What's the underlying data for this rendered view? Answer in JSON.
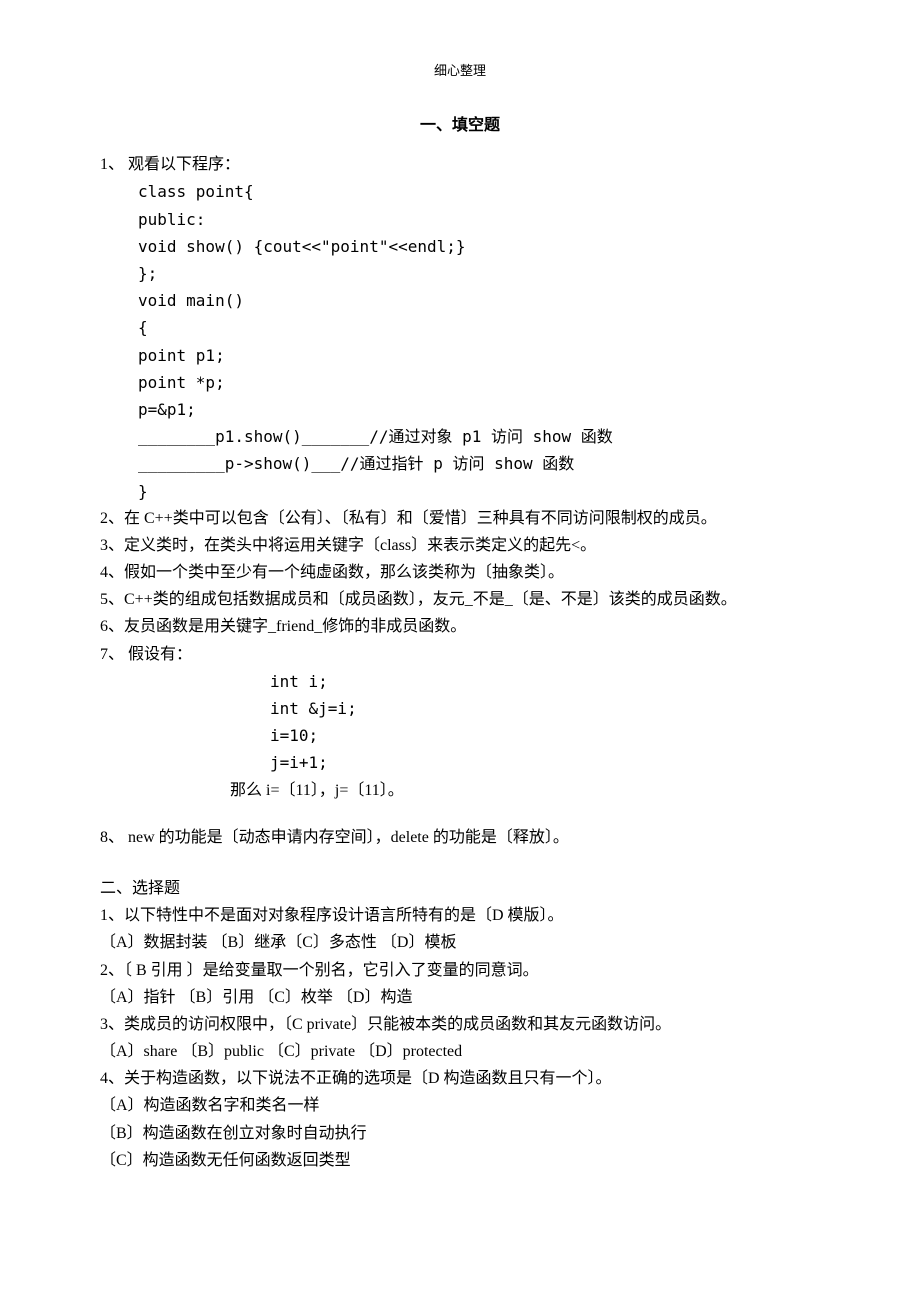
{
  "header": "细心整理",
  "section1": {
    "title": "一、填空题"
  },
  "q1": {
    "prefix": "1、",
    "text": "观看以下程序：",
    "c1": "class point{",
    "c2": " public:",
    "c3": "    void show() {cout<<\"point\"<<endl;}",
    "c4": " };",
    "c5": " void main()",
    "c6": " {",
    "c7": " point p1;",
    "c8": " point *p;",
    "c9": " p=&p1;",
    "c10": " ________p1.show()_______//通过对象 p1 访问 show 函数",
    "c11": " _________p->show()___//通过指针 p 访问 show 函数",
    "c12": " }"
  },
  "q2": "2、在 C++类中可以包含〔公有〕、〔私有〕和〔爱惜〕三种具有不同访问限制权的成员。",
  "q3": "3、定义类时，在类头中将运用关键字〔class〕来表示类定义的起先<。",
  "q4": "4、假如一个类中至少有一个纯虚函数，那么该类称为〔抽象类〕。",
  "q5": "5、C++类的组成包括数据成员和〔成员函数〕，友元_不是_〔是、不是〕该类的成员函数。",
  "q6": "6、友员函数是用关键字_friend_修饰的非成员函数。",
  "q7": {
    "prefix": "7、",
    "text": "假设有：",
    "c1": "int i;",
    "c2": "int &j=i;",
    "c3": "i=10;",
    "c4": "j=i+1;",
    "result": "那么 i=〔11〕，j=〔11〕。"
  },
  "q8": "8、 new 的功能是〔动态申请内存空间〕，delete 的功能是〔释放〕。",
  "section2": {
    "title": "二、选择题"
  },
  "mc1": {
    "stem": "1、以下特性中不是面对对象程序设计语言所特有的是〔D 模版〕。",
    "opts": "〔A〕数据封装    〔B〕继承〔C〕多态性     〔D〕模板"
  },
  "mc2": {
    "stem": "2、〔   B 引用   〕是给变量取一个别名，它引入了变量的同意词。",
    "opts": "〔A〕指针    〔B〕引用    〔C〕枚举    〔D〕构造"
  },
  "mc3": {
    "stem": "3、类成员的访问权限中，〔C private〕只能被本类的成员函数和其友元函数访问。",
    "opts": "〔A〕share   〔B〕public  〔C〕private     〔D〕protected"
  },
  "mc4": {
    "stem": "4、关于构造函数，以下说法不正确的选项是〔D 构造函数且只有一个〕。",
    "oA": "〔A〕构造函数名字和类名一样",
    "oB": "〔B〕构造函数在创立对象时自动执行",
    "oC": "〔C〕构造函数无任何函数返回类型"
  }
}
